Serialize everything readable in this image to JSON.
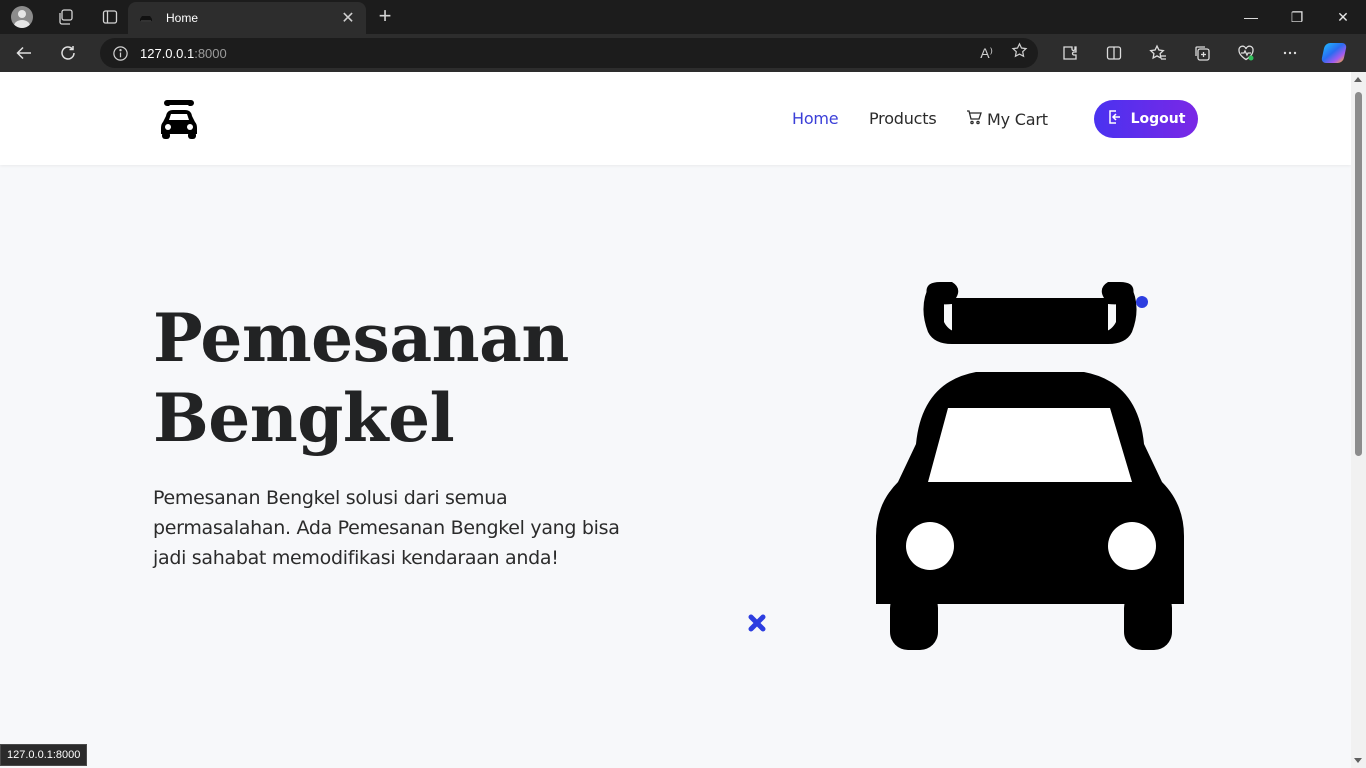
{
  "browser": {
    "tab": {
      "title": "Home"
    },
    "new_tab_symbol": "+",
    "address": {
      "host": "127.0.0.1",
      "port": ":8000"
    },
    "window_controls": {
      "minimize": "—",
      "restore": "❐",
      "close": "✕"
    },
    "icons": [
      "profile-avatar-icon",
      "workspaces-icon",
      "tab-actions-icon",
      "back-icon",
      "refresh-icon",
      "info-icon",
      "read-aloud-icon",
      "favorite-star-icon",
      "extensions-icon",
      "split-screen-icon",
      "favorites-icon",
      "collections-icon",
      "browser-essentials-icon",
      "more-icon",
      "copilot-icon"
    ],
    "read_aloud_label": "A⁾"
  },
  "site": {
    "nav": {
      "home": "Home",
      "products": "Products",
      "cart": "My Cart",
      "logout": "Logout"
    },
    "hero": {
      "title_line1": "Pemesanan",
      "title_line2": "Bengkel",
      "description": "Pemesanan Bengkel solusi dari semua permasalahan. Ada Pemesanan Bengkel yang bisa jadi sahabat memodifikasi kendaraan anda!"
    },
    "colors": {
      "accent": "#3b3fd8",
      "button_start": "#4a32f0",
      "button_end": "#7a28e6",
      "decoration": "#2d3ee0"
    }
  },
  "status_bar": {
    "url": "127.0.0.1:8000"
  }
}
